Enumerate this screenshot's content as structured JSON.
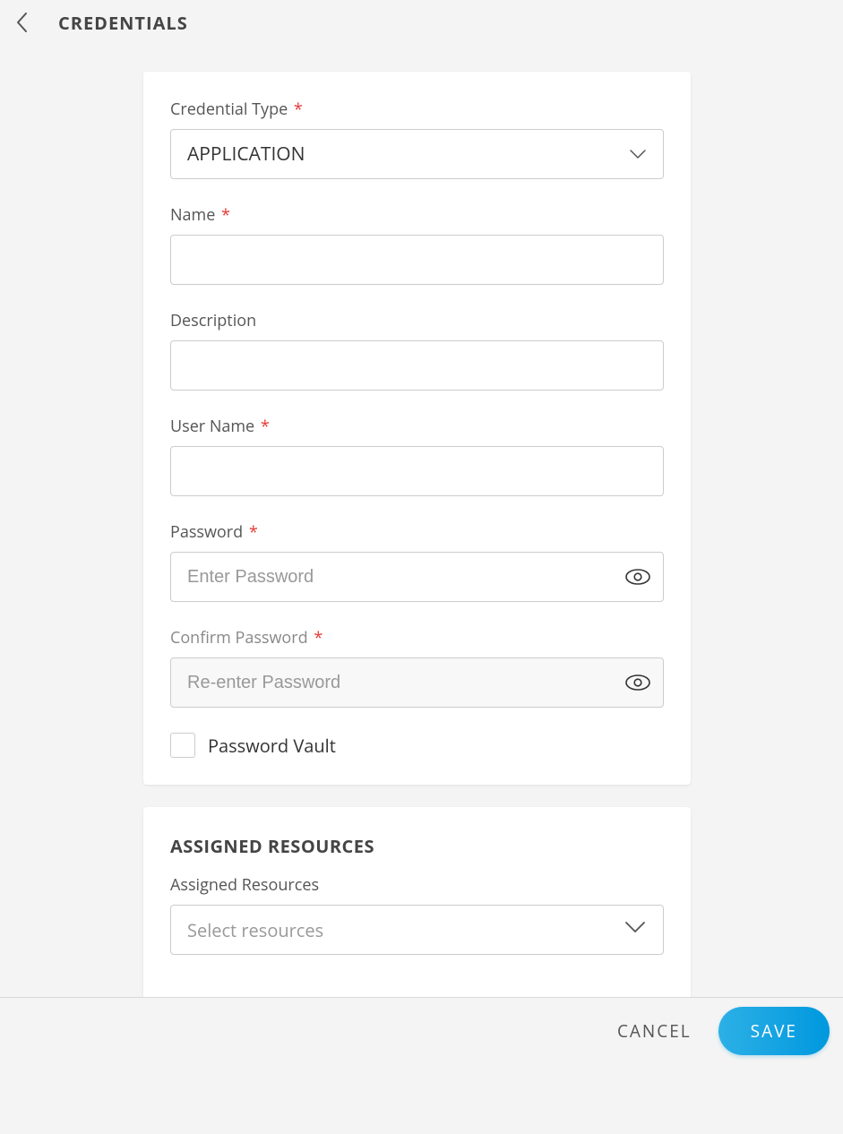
{
  "header": {
    "title": "CREDENTIALS"
  },
  "form": {
    "credential_type": {
      "label": "Credential Type",
      "required": true,
      "value": "APPLICATION"
    },
    "name": {
      "label": "Name",
      "required": true,
      "value": ""
    },
    "description": {
      "label": "Description",
      "required": false,
      "value": ""
    },
    "user_name": {
      "label": "User Name",
      "required": true,
      "value": ""
    },
    "password": {
      "label": "Password",
      "required": true,
      "value": "",
      "placeholder": "Enter Password"
    },
    "confirm_password": {
      "label": "Confirm Password",
      "required": true,
      "value": "",
      "placeholder": "Re-enter Password",
      "disabled": true
    },
    "password_vault": {
      "label": "Password Vault",
      "checked": false
    }
  },
  "resources": {
    "section_title": "ASSIGNED RESOURCES",
    "label": "Assigned Resources",
    "placeholder": "Select resources"
  },
  "footer": {
    "cancel": "CANCEL",
    "save": "SAVE"
  }
}
